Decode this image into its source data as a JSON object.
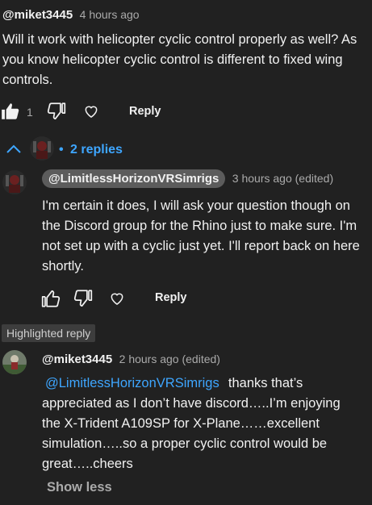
{
  "comment": {
    "author": "@miket3445",
    "time": "4 hours ago",
    "text": "Will it work with helicopter cyclic control properly as well? As you know helicopter cyclic control is different to fixed wing controls.",
    "like_count": "1",
    "reply_label": "Reply"
  },
  "replies_toggle": {
    "dot": "•",
    "label": "2 replies"
  },
  "reply1": {
    "author": "@LimitlessHorizonVRSimrigs",
    "time": "3 hours ago (edited)",
    "text": "I'm certain it does, I will ask your question though on the Discord group for the Rhino just to make sure. I'm not set up with a cyclic just yet. I'll report back on here shortly.",
    "reply_label": "Reply"
  },
  "reply2": {
    "badge": "Highlighted reply",
    "author": "@miket3445",
    "time": "2 hours ago (edited)",
    "mention": "@LimitlessHorizonVRSimrigs",
    "text": "thanks that’s appreciated as I don’t have discord…..I’m enjoying the X-Trident A109SP for X-Plane……excellent simulation…..so a proper cyclic control would be great…..cheers",
    "show_less": "Show less"
  },
  "colors": {
    "background": "#212121",
    "text": "#f1f1f1",
    "secondary": "#aaaaaa",
    "link": "#3ea6ff"
  },
  "icons": [
    "thumbs-up-filled-icon",
    "thumbs-down-icon",
    "heart-icon",
    "chevron-up-icon"
  ]
}
